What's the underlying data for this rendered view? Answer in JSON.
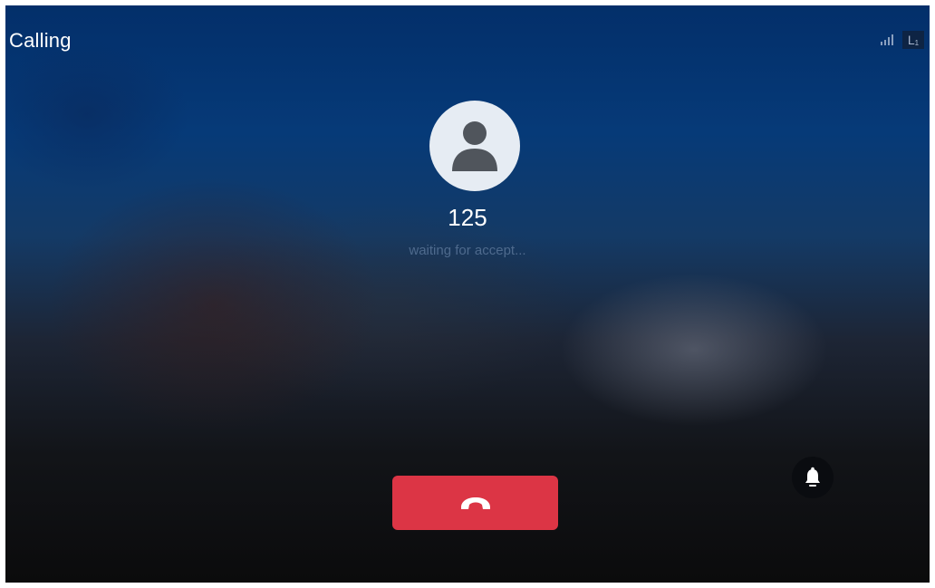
{
  "header": {
    "title": "Calling",
    "line_label": "L",
    "line_number": "1"
  },
  "status_icons": [
    "signal-icon",
    "line-1-icon"
  ],
  "caller": {
    "number": "125",
    "status": "waiting for accept..."
  },
  "actions": {
    "hangup_icon": "phone-hangup-icon",
    "alert_icon": "bell-icon"
  },
  "colors": {
    "hangup_button": "#dc3545",
    "avatar_bg": "#e6ecf3",
    "avatar_fg": "#50555c",
    "status_text": "#4e6a8d"
  }
}
